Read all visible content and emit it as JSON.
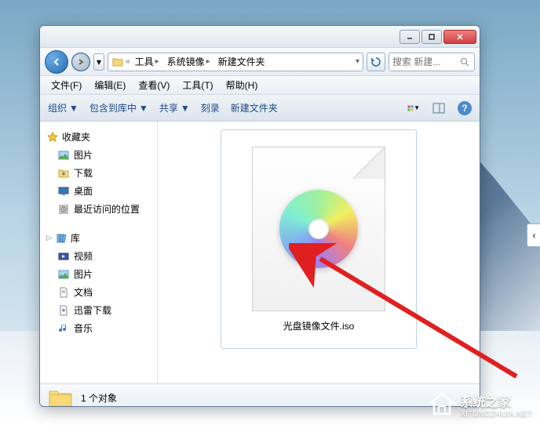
{
  "titlebar": {
    "min": "–",
    "max": "□",
    "close": "×"
  },
  "nav": {
    "back": "←",
    "fwd": "→",
    "drop": "▾"
  },
  "breadcrumb": {
    "segs": [
      "工具",
      "系统镜像",
      "新建文件夹"
    ],
    "prefix": "«"
  },
  "refresh": "↻",
  "search": {
    "placeholder": "搜索 新建...",
    "icon": "🔍"
  },
  "menubar": {
    "items": [
      "文件(F)",
      "编辑(E)",
      "查看(V)",
      "工具(T)",
      "帮助(H)"
    ]
  },
  "toolbar": {
    "organize": "组织",
    "include": "包含到库中",
    "share": "共享",
    "burn": "刻录",
    "newfolder": "新建文件夹",
    "drop": "▼",
    "help": "?"
  },
  "sidebar": {
    "favorites": {
      "label": "收藏夹",
      "items": [
        "图片",
        "下载",
        "桌面",
        "最近访问的位置"
      ]
    },
    "libraries": {
      "label": "库",
      "items": [
        "视频",
        "图片",
        "文档",
        "迅雷下载",
        "音乐"
      ]
    },
    "tri": "▷"
  },
  "main": {
    "filename": "光盘镜像文件.iso"
  },
  "statusbar": {
    "count": "1 个对象"
  },
  "watermark": {
    "title": "系统之家",
    "url": "XITONGZHIJIA.NET"
  },
  "expand": "‹"
}
